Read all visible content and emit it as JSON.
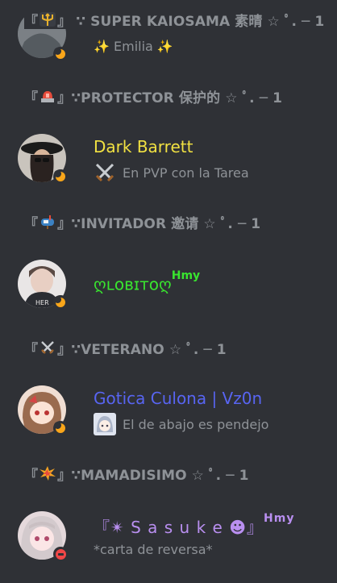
{
  "colors": {
    "background": "#2f3136",
    "header": "#8e9297",
    "activity": "#8e9297",
    "idle": "#faa61a",
    "dnd": "#f04747"
  },
  "sections": [
    {
      "open": "『",
      "icon": "trident-icon",
      "close": "』",
      "label": "∵ SUPER KAIOSAMA 素晴 ☆ ﾟ. ─ 1"
    },
    {
      "open": "『",
      "icon": "siren-icon",
      "close": "』",
      "label": "∵PROTECTOR 保护的 ☆ ﾟ. ─ 1"
    },
    {
      "open": "『",
      "icon": "mailbox-icon",
      "close": "』",
      "label": "∵INVITADOR 邀请 ☆ ﾟ. ─ 1"
    },
    {
      "open": "『",
      "icon": "crossed-swords-icon",
      "close": "』",
      "label": "∵VETERANO ☆ ﾟ. ─ 1"
    },
    {
      "open": "『",
      "icon": "collision-icon",
      "close": "』",
      "label": "∵MAMADISIMO ☆ ﾟ. ─ 1"
    }
  ],
  "members": [
    {
      "name": "",
      "color": "#dcddde",
      "activity": "✨ Emilia ✨",
      "status": "idle"
    },
    {
      "name": "Dark Barrett",
      "color": "#f1e142",
      "activity": "En PVP con la Tarea",
      "activity_icon": "crossed-swords-icon",
      "status": "idle"
    },
    {
      "name": "ღʟᴏʙɪᴛᴏღ",
      "tag": "Hmy",
      "color": "#39e52f",
      "activity": "",
      "status": "idle"
    },
    {
      "name": "Gotica Culona | Vz0n",
      "color": "#5865f2",
      "activity": "El de abajo es pendejo",
      "activity_icon": "anime-girl-icon",
      "status": "idle"
    },
    {
      "name": "『✴ S a s u k e ☻』",
      "tag": "Hmy",
      "color": "#b98ff0",
      "activity": "*carta de reversa*",
      "status": "dnd"
    }
  ]
}
